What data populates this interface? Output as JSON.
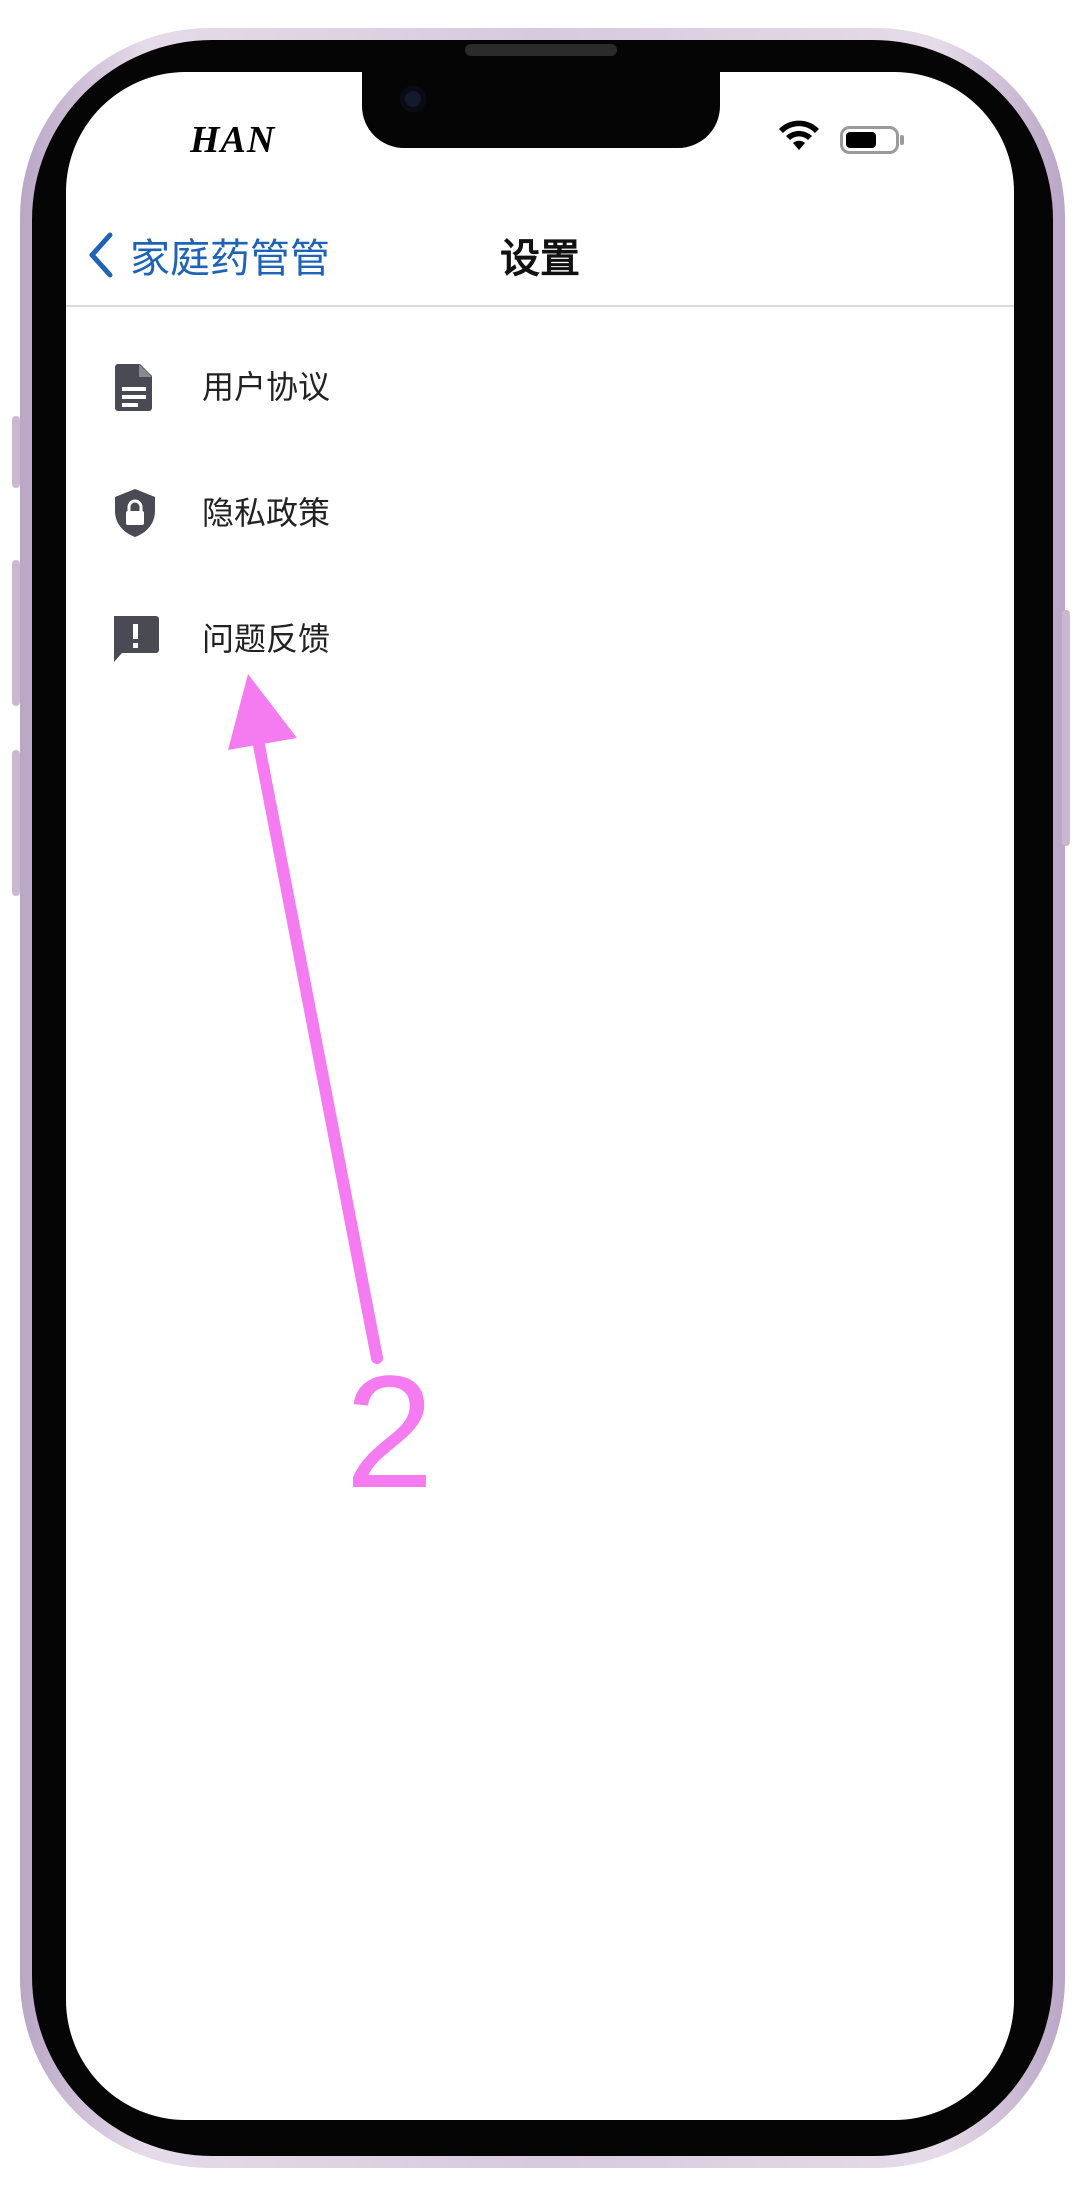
{
  "status_bar": {
    "carrier": "HAN",
    "wifi_icon": "wifi-icon",
    "battery_icon": "battery-icon"
  },
  "nav_bar": {
    "back_label": "家庭药管管",
    "title": "设置"
  },
  "settings_items": [
    {
      "label": "用户协议",
      "icon": "document-icon"
    },
    {
      "label": "隐私政策",
      "icon": "shield-lock-icon"
    },
    {
      "label": "问题反馈",
      "icon": "feedback-icon"
    }
  ],
  "annotation": {
    "number": "2",
    "color": "#f47cf0"
  },
  "colors": {
    "accent": "#1e63b6",
    "icon": "#4a4a55"
  }
}
